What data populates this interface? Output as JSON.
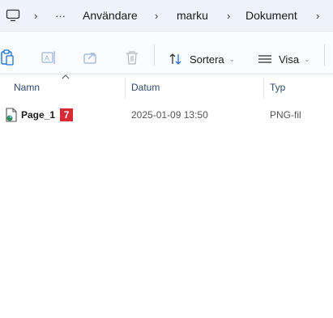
{
  "breadcrumb": {
    "more": "···",
    "items": [
      "Användare",
      "marku",
      "Dokument"
    ],
    "separator": "›"
  },
  "toolbar": {
    "sort_label": "Sortera",
    "view_label": "Visa",
    "icons": [
      "paste-icon",
      "rename-icon",
      "share-icon",
      "delete-icon",
      "sort-icon",
      "view-icon"
    ]
  },
  "columns": {
    "name": "Namn",
    "date": "Datum",
    "type": "Typ"
  },
  "files": [
    {
      "name": "Page_1",
      "badge": "7",
      "date": "2025-01-09 13:50",
      "type": "PNG-fil"
    }
  ],
  "colors": {
    "badge": "#d62b33",
    "accent": "#1f6fd1"
  }
}
